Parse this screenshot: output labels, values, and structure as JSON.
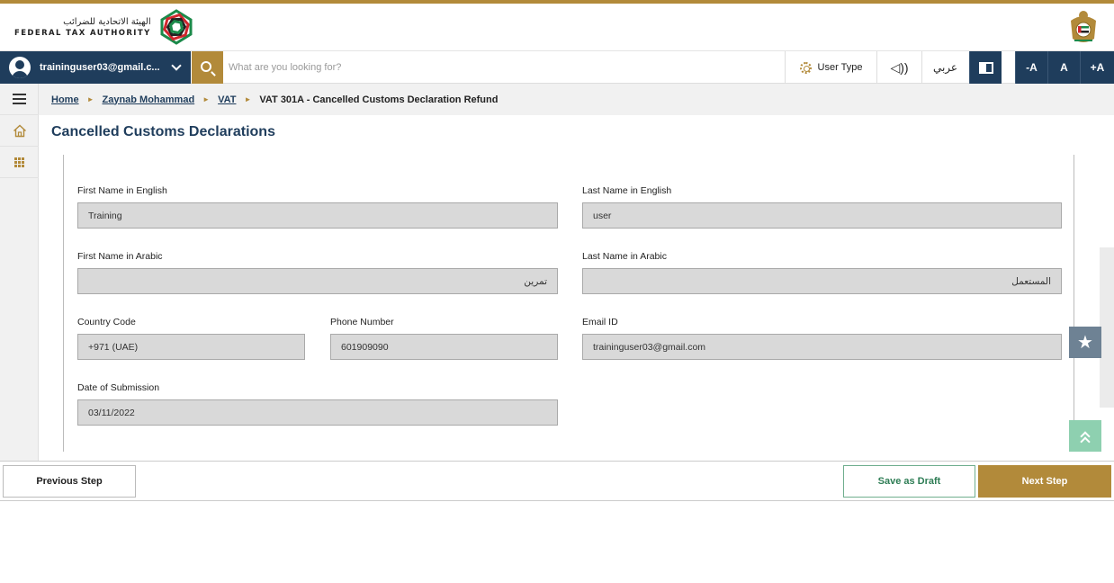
{
  "header": {
    "logo_arabic": "الهيئة الاتحادية للضرائب",
    "logo_english": "FEDERAL TAX AUTHORITY"
  },
  "toolbar": {
    "user_email": "traininguser03@gmail.c...",
    "search_placeholder": "What are you looking for?",
    "user_type_label": "User Type",
    "speaker_glyph": "◁))",
    "language_label": "عربي",
    "font_decrease_label": "-A",
    "font_reset_label": "A",
    "font_increase_label": "+A"
  },
  "breadcrumb": {
    "items": [
      "Home",
      "Zaynab Mohammad",
      "VAT"
    ],
    "separator": "►",
    "current": "VAT 301A - Cancelled Customs Declaration Refund"
  },
  "page": {
    "title": "Cancelled Customs Declarations"
  },
  "form": {
    "first_name_en": {
      "label": "First Name in English",
      "value": "Training"
    },
    "last_name_en": {
      "label": "Last Name in English",
      "value": "user"
    },
    "first_name_ar": {
      "label": "First Name in Arabic",
      "value": "تمرين"
    },
    "last_name_ar": {
      "label": "Last Name in Arabic",
      "value": "المستعمل"
    },
    "country_code": {
      "label": "Country Code",
      "value": "+971 (UAE)"
    },
    "phone_number": {
      "label": "Phone Number",
      "value": "601909090"
    },
    "email": {
      "label": "Email ID",
      "value": "traininguser03@gmail.com"
    },
    "submission_date": {
      "label": "Date of Submission",
      "value": "03/11/2022"
    }
  },
  "floating": {
    "favorite_glyph": "★"
  },
  "footer": {
    "previous_label": "Previous Step",
    "draft_label": "Save as Draft",
    "next_label": "Next Step"
  },
  "colors": {
    "navy": "#1f3d5c",
    "gold": "#b28a3a",
    "green": "#2e7d55",
    "field_bg": "#d9d9d9"
  }
}
